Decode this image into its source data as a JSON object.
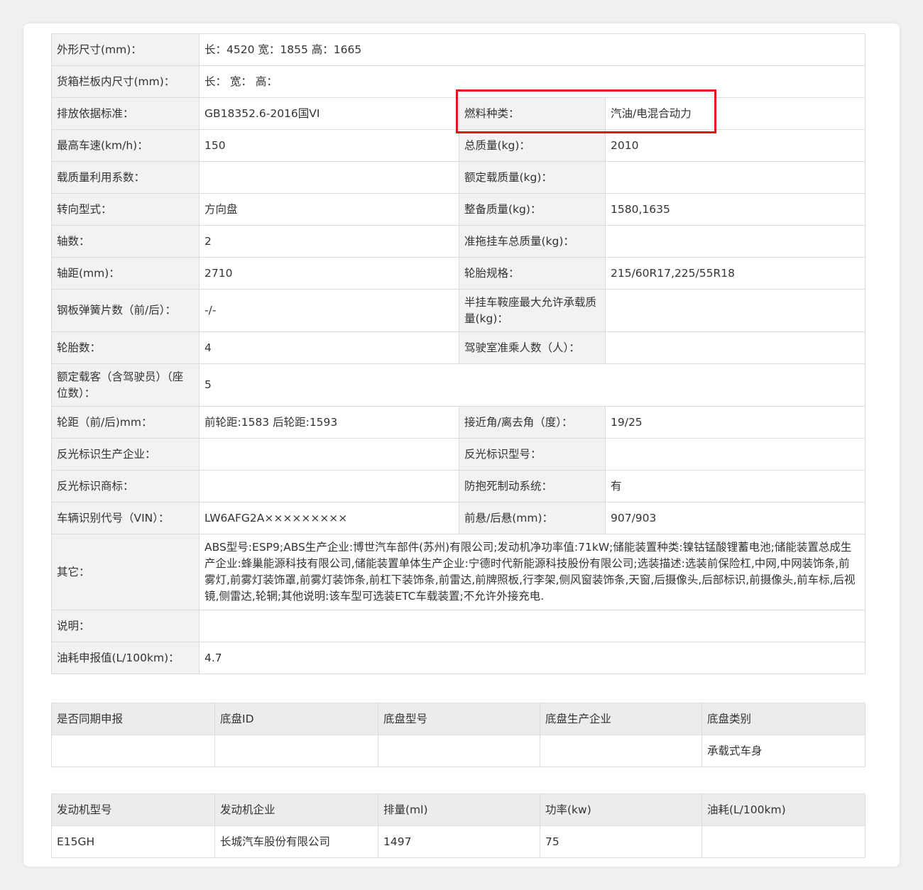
{
  "spec": {
    "dimensions_label": "外形尺寸(mm)：",
    "dimensions_value": "长：4520 宽：1855 高：1665",
    "cargo_label": "货箱栏板内尺寸(mm)：",
    "cargo_value": "长：   宽：   高：",
    "emission_label": "排放依据标准：",
    "emission_value": "GB18352.6-2016国VI",
    "fuel_label": "燃料种类：",
    "fuel_value": "汽油/电混合动力",
    "max_speed_label": "最高车速(km/h)：",
    "max_speed_value": "150",
    "total_mass_label": "总质量(kg)：",
    "total_mass_value": "2010",
    "load_coef_label": "载质量利用系数：",
    "load_coef_value": "",
    "rated_load_label": "额定载质量(kg)：",
    "rated_load_value": "",
    "steering_label": "转向型式：",
    "steering_value": "方向盘",
    "curb_mass_label": "整备质量(kg)：",
    "curb_mass_value": "1580,1635",
    "axles_label": "轴数：",
    "axles_value": "2",
    "trailer_label": "准拖挂车总质量(kg)：",
    "trailer_value": "",
    "wheelbase_label": "轴距(mm)：",
    "wheelbase_value": "2710",
    "tire_spec_label": "轮胎规格：",
    "tire_spec_value": "215/60R17,225/55R18",
    "springs_label": "钢板弹簧片数（前/后）：",
    "springs_value": "-/-",
    "saddle_label": "半挂车鞍座最大允许承载质量(kg)：",
    "saddle_value": "",
    "tires_label": "轮胎数：",
    "tires_value": "4",
    "cab_label": "驾驶室准乘人数（人）：",
    "cab_value": "",
    "seats_label": "额定载客（含驾驶员）（座位数）：",
    "seats_value": "5",
    "track_label": "轮距（前/后)mm：",
    "track_value": "前轮距:1583 后轮距:1593",
    "angle_label": "接近角/离去角（度）：",
    "angle_value": "19/25",
    "reflect_maker_label": "反光标识生产企业：",
    "reflect_maker_value": "",
    "reflect_model_label": "反光标识型号：",
    "reflect_model_value": "",
    "reflect_brand_label": "反光标识商标：",
    "reflect_brand_value": "",
    "abs_label": "防抱死制动系统：",
    "abs_value": "有",
    "vin_label": "车辆识别代号（VIN）：",
    "vin_value": "LW6AFG2A×××××××××",
    "overhang_label": "前悬/后悬(mm)：",
    "overhang_value": "907/903",
    "other_label": "其它：",
    "other_value": "ABS型号:ESP9;ABS生产企业:博世汽车部件(苏州)有限公司;发动机净功率值:71kW;储能装置种类:镍钴锰酸锂蓄电池;储能装置总成生产企业:蜂巢能源科技有限公司,储能装置单体生产企业:宁德时代新能源科技股份有限公司;选装描述:选装前保险杠,中网,中网装饰条,前雾灯,前雾灯装饰罩,前雾灯装饰条,前杠下装饰条,前雷达,前牌照板,行李架,侧风窗装饰条,天窗,后摄像头,后部标识,前摄像头,前车标,后视镜,侧雷达,轮辋;其他说明:该车型可选装ETC车载装置;不允许外接充电.",
    "note_label": "说明：",
    "note_value": "",
    "fuel_decl_label": "油耗申报值(L/100km)：",
    "fuel_decl_value": "4.7"
  },
  "chassis": {
    "headers": [
      "是否同期申报",
      "底盘ID",
      "底盘型号",
      "底盘生产企业",
      "底盘类别"
    ],
    "row": [
      "",
      "",
      "",
      "",
      "承载式车身"
    ]
  },
  "engine": {
    "headers": [
      "发动机型号",
      "发动机企业",
      "排量(ml)",
      "功率(kw)",
      "油耗(L/100km)"
    ],
    "row": [
      "E15GH",
      "长城汽车股份有限公司",
      "1497",
      "75",
      ""
    ]
  },
  "highlight_color": "#e0161a"
}
